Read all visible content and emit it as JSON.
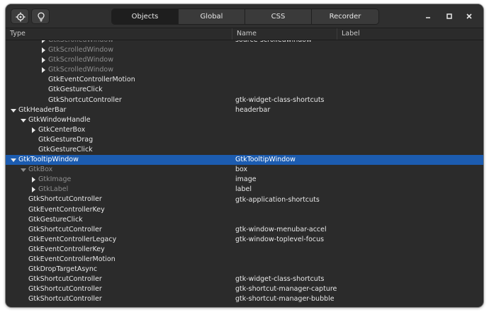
{
  "header": {
    "left_buttons": [
      {
        "icon": "target-select-icon"
      },
      {
        "icon": "lightbulb-icon"
      }
    ],
    "tabs": [
      {
        "label": "Objects",
        "active": true
      },
      {
        "label": "Global",
        "active": false
      },
      {
        "label": "CSS",
        "active": false
      },
      {
        "label": "Recorder",
        "active": false
      }
    ],
    "window_controls": [
      "minimize-icon",
      "maximize-icon",
      "close-icon"
    ]
  },
  "columns": {
    "type": "Type",
    "name": "Name",
    "label": "Label"
  },
  "colors": {
    "selection": "#1c5cb0",
    "window_bg": "#2b2b2b"
  },
  "rows": [
    {
      "indent": 4,
      "expander": "right",
      "type": "GtkScrolledWindow",
      "name": "source-scrolledwindow",
      "label": "",
      "dim": true,
      "clipped": true
    },
    {
      "indent": 4,
      "expander": "right",
      "type": "GtkScrolledWindow",
      "name": "",
      "label": "",
      "dim": true
    },
    {
      "indent": 4,
      "expander": "right",
      "type": "GtkScrolledWindow",
      "name": "",
      "label": "",
      "dim": true
    },
    {
      "indent": 4,
      "expander": "right",
      "type": "GtkScrolledWindow",
      "name": "",
      "label": "",
      "dim": true
    },
    {
      "indent": 4,
      "expander": "",
      "type": "GtkEventControllerMotion",
      "name": "",
      "label": ""
    },
    {
      "indent": 4,
      "expander": "",
      "type": "GtkGestureClick",
      "name": "",
      "label": ""
    },
    {
      "indent": 4,
      "expander": "",
      "type": "GtkShortcutController",
      "name": "gtk-widget-class-shortcuts",
      "label": ""
    },
    {
      "indent": 1,
      "expander": "down",
      "type": "GtkHeaderBar",
      "name": "headerbar",
      "label": ""
    },
    {
      "indent": 2,
      "expander": "down",
      "type": "GtkWindowHandle",
      "name": "",
      "label": ""
    },
    {
      "indent": 3,
      "expander": "right",
      "type": "GtkCenterBox",
      "name": "",
      "label": ""
    },
    {
      "indent": 3,
      "expander": "",
      "type": "GtkGestureDrag",
      "name": "",
      "label": ""
    },
    {
      "indent": 3,
      "expander": "",
      "type": "GtkGestureClick",
      "name": "",
      "label": ""
    },
    {
      "indent": 1,
      "expander": "down",
      "type": "GtkTooltipWindow",
      "name": "GtkTooltipWindow",
      "label": "",
      "selected": true
    },
    {
      "indent": 2,
      "expander": "down",
      "type": "GtkBox",
      "name": "box",
      "label": "",
      "dim": true
    },
    {
      "indent": 3,
      "expander": "right",
      "type": "GtkImage",
      "name": "image",
      "label": "",
      "dim": true
    },
    {
      "indent": 3,
      "expander": "right",
      "type": "GtkLabel",
      "name": "label",
      "label": "",
      "dim": true
    },
    {
      "indent": 2,
      "expander": "",
      "type": "GtkShortcutController",
      "name": "gtk-application-shortcuts",
      "label": ""
    },
    {
      "indent": 2,
      "expander": "",
      "type": "GtkEventControllerKey",
      "name": "",
      "label": ""
    },
    {
      "indent": 2,
      "expander": "",
      "type": "GtkGestureClick",
      "name": "",
      "label": ""
    },
    {
      "indent": 2,
      "expander": "",
      "type": "GtkShortcutController",
      "name": "gtk-window-menubar-accel",
      "label": ""
    },
    {
      "indent": 2,
      "expander": "",
      "type": "GtkEventControllerLegacy",
      "name": "gtk-window-toplevel-focus",
      "label": ""
    },
    {
      "indent": 2,
      "expander": "",
      "type": "GtkEventControllerKey",
      "name": "",
      "label": ""
    },
    {
      "indent": 2,
      "expander": "",
      "type": "GtkEventControllerMotion",
      "name": "",
      "label": ""
    },
    {
      "indent": 2,
      "expander": "",
      "type": "GtkDropTargetAsync",
      "name": "",
      "label": ""
    },
    {
      "indent": 2,
      "expander": "",
      "type": "GtkShortcutController",
      "name": "gtk-widget-class-shortcuts",
      "label": ""
    },
    {
      "indent": 2,
      "expander": "",
      "type": "GtkShortcutController",
      "name": "gtk-shortcut-manager-capture",
      "label": ""
    },
    {
      "indent": 2,
      "expander": "",
      "type": "GtkShortcutController",
      "name": "gtk-shortcut-manager-bubble",
      "label": ""
    }
  ]
}
